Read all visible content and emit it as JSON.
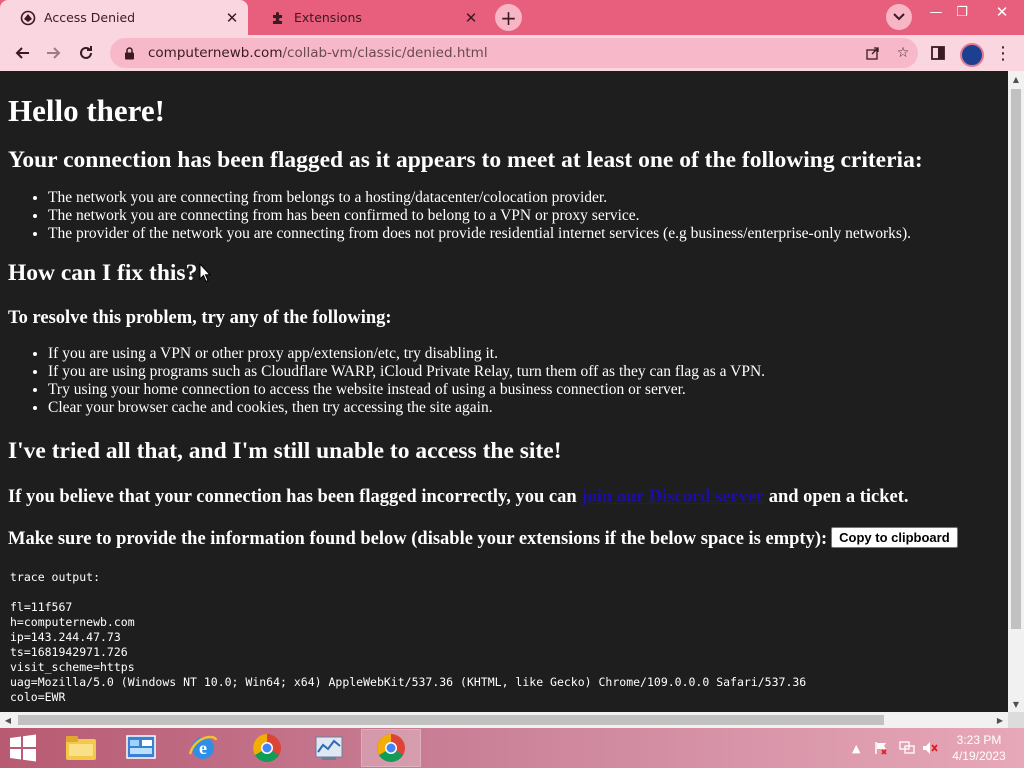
{
  "browser": {
    "tabs": [
      {
        "title": "Access Denied",
        "active": true
      },
      {
        "title": "Extensions",
        "active": false
      }
    ],
    "new_tab": "+",
    "url_host": "computernewb.com",
    "url_path": "/collab-vm/classic/denied.html",
    "accent": "#e75f7c"
  },
  "page": {
    "h1": "Hello there!",
    "h2_flagged": "Your connection has been flagged as it appears to meet at least one of the following criteria:",
    "criteria": [
      "The network you are connecting from belongs to a hosting/datacenter/colocation provider.",
      "The network you are connecting from has been confirmed to belong to a VPN or proxy service.",
      "The provider of the network you are connecting from does not provide residential internet services (e.g business/enterprise-only networks)."
    ],
    "h2_fix": "How can I fix this?",
    "h3_resolve": "To resolve this problem, try any of the following:",
    "fixes": [
      "If you are using a VPN or other proxy app/extension/etc, try disabling it.",
      "If you are using programs such as Cloudflare WARP, iCloud Private Relay, turn them off as they can flag as a VPN.",
      "Try using your home connection to access the website instead of using a business connection or server.",
      "Clear your browser cache and cookies, then try accessing the site again."
    ],
    "h2_tried": "I've tried all that, and I'm still unable to access the site!",
    "ticket_before": "If you believe that your connection has been flagged incorrectly, you can ",
    "ticket_link": "join our Discord server",
    "ticket_after": " and open a ticket.",
    "provide_info": "Make sure to provide the information found below (disable your extensions if the below space is empty):",
    "copy_button": "Copy to clipboard",
    "trace_header": "trace output:",
    "trace_lines": [
      "fl=11f567",
      "h=computernewb.com",
      "ip=143.244.47.73",
      "ts=1681942971.726",
      "visit_scheme=https",
      "uag=Mozilla/5.0 (Windows NT 10.0; Win64; x64) AppleWebKit/537.36 (KHTML, like Gecko) Chrome/109.0.0.0 Safari/537.36",
      "colo=EWR"
    ]
  },
  "taskbar": {
    "time": "3:23 PM",
    "date": "4/19/2023"
  }
}
